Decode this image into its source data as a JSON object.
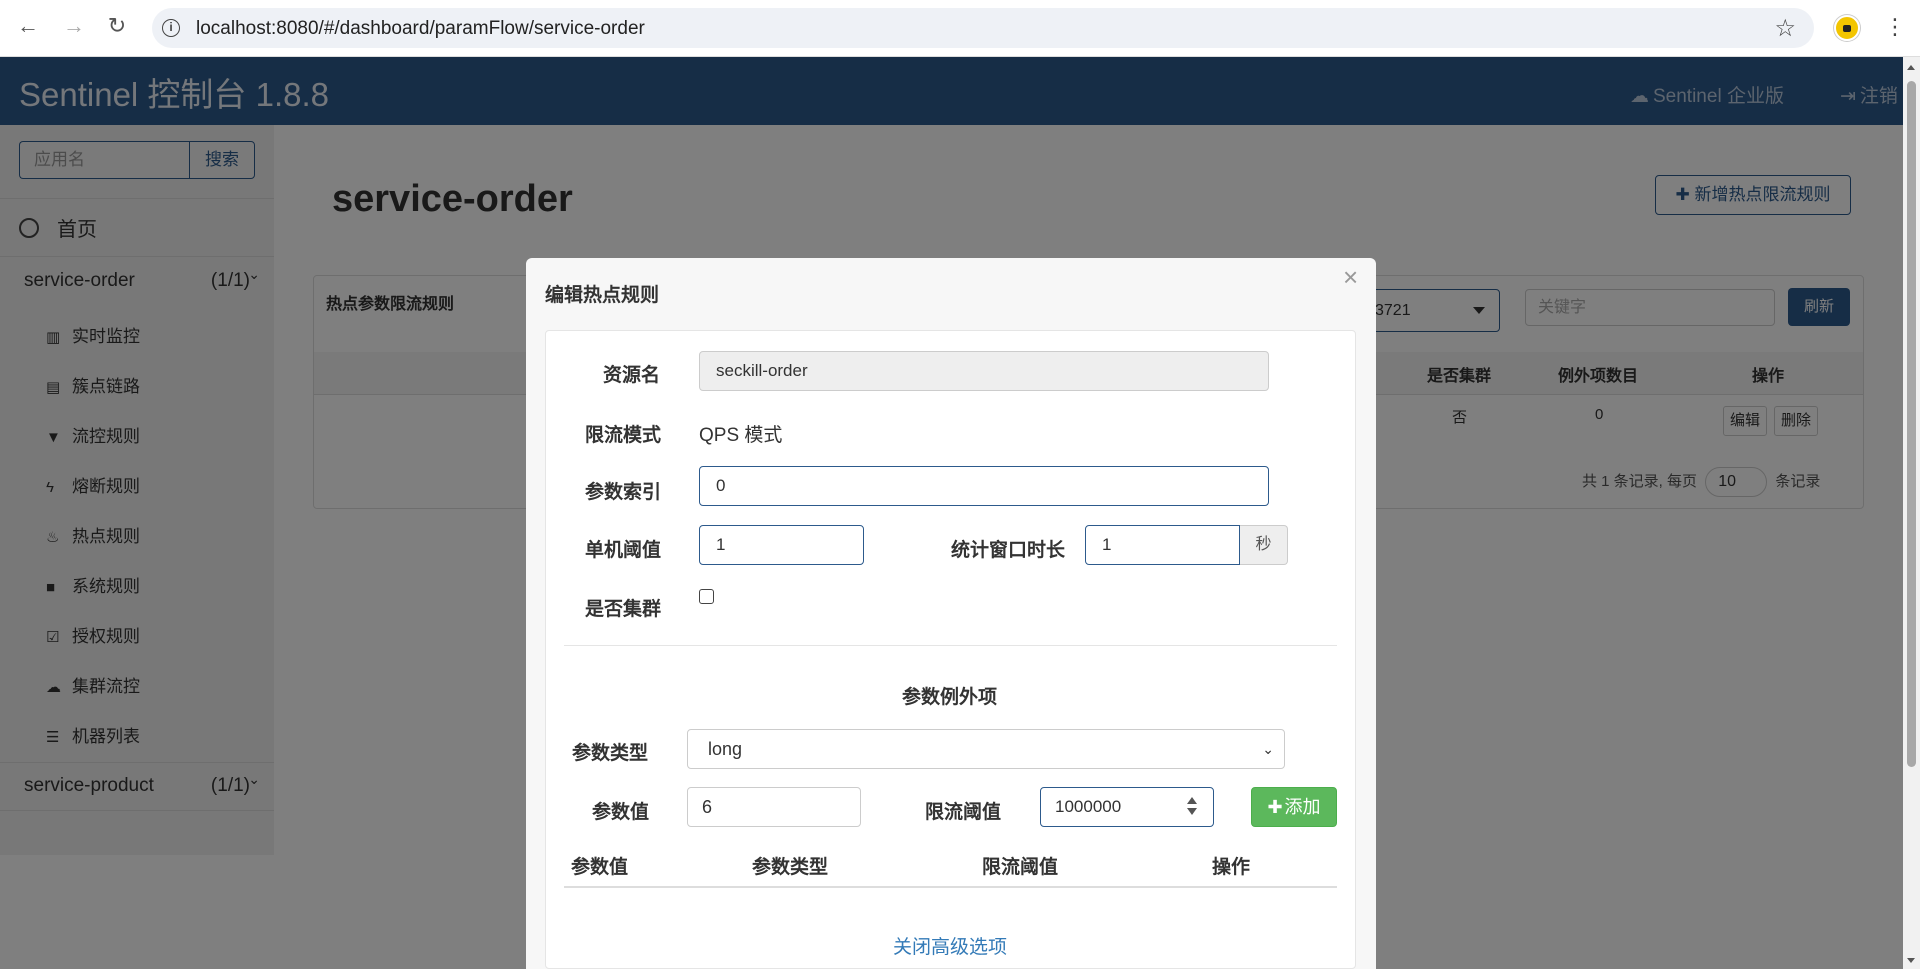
{
  "browser": {
    "url": "localhost:8080/#/dashboard/paramFlow/service-order"
  },
  "header": {
    "brand": "Sentinel 控制台 1.8.8",
    "enterprise": "Sentinel 企业版",
    "logout": "注销"
  },
  "sidebar": {
    "search_placeholder": "应用名",
    "search_button": "搜索",
    "home": "首页",
    "apps": [
      {
        "name": "service-order",
        "count": "(1/1)"
      },
      {
        "name": "service-product",
        "count": "(1/1)"
      }
    ],
    "menu": [
      {
        "label": "实时监控",
        "icon": "bar-chart-icon"
      },
      {
        "label": "簇点链路",
        "icon": "list-icon"
      },
      {
        "label": "流控规则",
        "icon": "filter-icon"
      },
      {
        "label": "熔断规则",
        "icon": "flash-icon"
      },
      {
        "label": "热点规则",
        "icon": "fire-icon"
      },
      {
        "label": "系统规则",
        "icon": "lock-icon"
      },
      {
        "label": "授权规则",
        "icon": "check-icon"
      },
      {
        "label": "集群流控",
        "icon": "cloud-icon"
      },
      {
        "label": "机器列表",
        "icon": "th-list-icon"
      }
    ]
  },
  "main": {
    "title": "service-order",
    "add_rule_button": "新增热点限流规则",
    "panel_title": "热点参数限流规则",
    "machine_select": "3721",
    "keyword_placeholder": "关键字",
    "refresh_button": "刷新",
    "columns": [
      "是否集群",
      "例外项数目",
      "操作"
    ],
    "row": {
      "cluster": "否",
      "exception_count": "0",
      "edit": "编辑",
      "delete": "删除"
    },
    "pager": {
      "prefix": "共 1 条记录, 每页",
      "page_size": "10",
      "suffix": "条记录"
    }
  },
  "modal": {
    "title": "编辑热点规则",
    "close": "×",
    "resource_label": "资源名",
    "resource_value": "seckill-order",
    "mode_label": "限流模式",
    "mode_value": "QPS 模式",
    "index_label": "参数索引",
    "index_value": "0",
    "threshold_label": "单机阈值",
    "threshold_value": "1",
    "window_label": "统计窗口时长",
    "window_value": "1",
    "window_unit": "秒",
    "cluster_label": "是否集群",
    "cluster_checked": false,
    "exception_title": "参数例外项",
    "param_type_label": "参数类型",
    "param_type_value": "long",
    "param_value_label": "参数值",
    "param_value": "6",
    "limit_label": "限流阈值",
    "limit_value": "1000000",
    "add_button": "添加",
    "exception_columns": [
      "参数值",
      "参数类型",
      "限流阈值",
      "操作"
    ],
    "advanced_link": "关闭高级选项"
  },
  "colors": {
    "brand_blue": "#2d5a8c",
    "success_green": "#5cb85c",
    "link_blue": "#337ab7"
  }
}
